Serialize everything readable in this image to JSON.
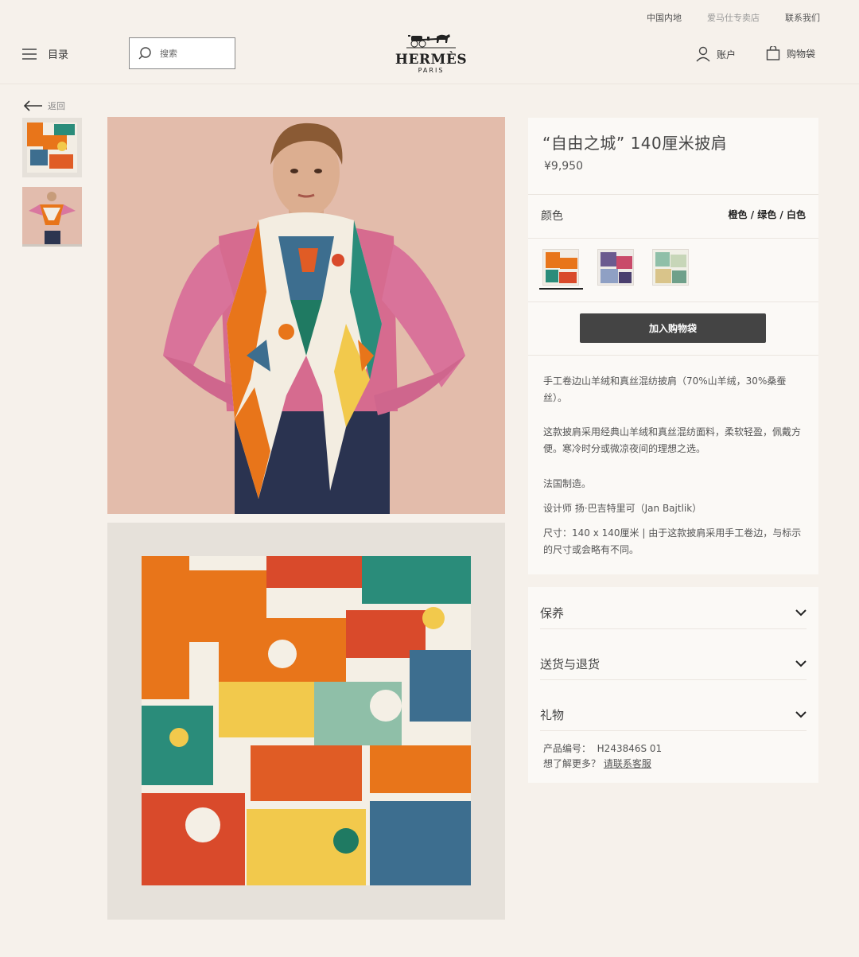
{
  "header": {
    "utility": {
      "region": "中国内地",
      "stores": "爱马仕专卖店",
      "contact": "联系我们"
    },
    "menu_label": "目录",
    "search_placeholder": "搜索",
    "logo": {
      "name": "HERMÈS",
      "city": "PARIS"
    },
    "account_label": "账户",
    "bag_label": "购物袋"
  },
  "back_label": "返回",
  "product": {
    "title": "“自由之城” 140厘米披肩",
    "price": "¥9,950",
    "color_label": "颜色",
    "color_value": "橙色 / 绿色 / 白色",
    "add_to_bag": "加入购物袋",
    "description": [
      "手工卷边山羊绒和真丝混纺披肩（70%山羊绒，30%桑蚕丝）。",
      "这款披肩采用经典山羊绒和真丝混纺面料，柔软轻盈，佩戴方便。寒冷时分或微凉夜间的理想之选。",
      "法国制造。",
      "设计师 扬·巴吉特里可（Jan Bajtlik）",
      "尺寸：140 x 140厘米 | 由于这款披肩采用手工卷边，与标示的尺寸或会略有不同。"
    ]
  },
  "accordion": [
    "保养",
    "送货与退货",
    "礼物"
  ],
  "meta": {
    "ref_label": "产品编号：",
    "ref_value": "H243846S 01",
    "more_label": "想了解更多？",
    "more_link": "请联系客服"
  },
  "colors": {
    "background": "#f6f1eb",
    "card": "#fbf9f6",
    "button": "#444444",
    "accent_orange": "#e8751a"
  }
}
